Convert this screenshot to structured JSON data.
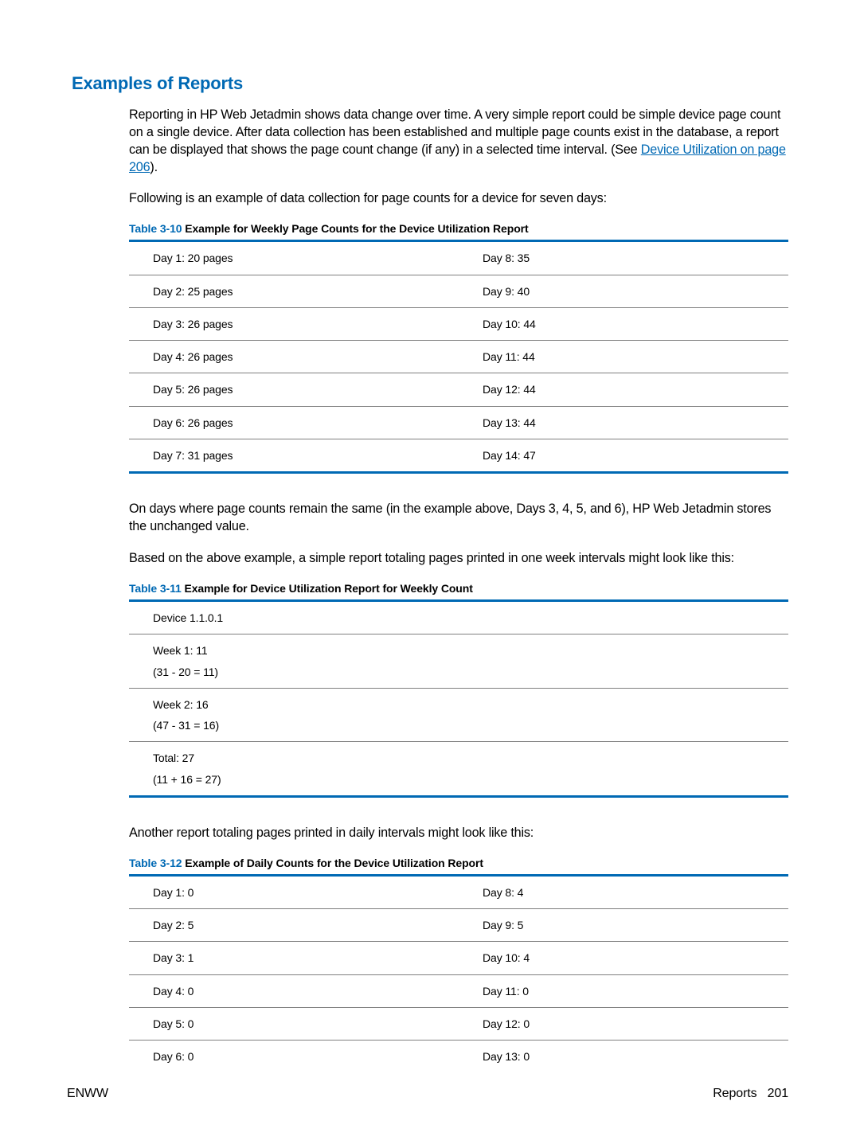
{
  "heading": "Examples of Reports",
  "para1_a": "Reporting in HP Web Jetadmin shows data change over time. A very simple report could be simple device page count on a single device. After data collection has been established and multiple page counts exist in the database, a report can be displayed that shows the page count change (if any) in a selected time interval. (See ",
  "para1_link": "Device Utilization on page 206",
  "para1_b": ").",
  "para2": "Following is an example of data collection for page counts for a device for seven days:",
  "table1": {
    "caption_prefix": "Table 3-10",
    "caption_title": "  Example for Weekly Page Counts for the Device Utilization Report",
    "rows": [
      {
        "l": "Day 1: 20 pages",
        "r": "Day 8: 35"
      },
      {
        "l": "Day 2: 25 pages",
        "r": "Day 9: 40"
      },
      {
        "l": "Day 3: 26 pages",
        "r": "Day 10: 44"
      },
      {
        "l": "Day 4: 26 pages",
        "r": "Day 11: 44"
      },
      {
        "l": "Day 5: 26 pages",
        "r": "Day 12: 44"
      },
      {
        "l": "Day 6: 26 pages",
        "r": "Day 13: 44"
      },
      {
        "l": "Day 7: 31 pages",
        "r": "Day 14: 47"
      }
    ]
  },
  "para3": "On days where page counts remain the same (in the example above, Days 3, 4, 5, and 6), HP Web Jetadmin stores the unchanged value.",
  "para4": "Based on the above example, a simple report totaling pages printed in one week intervals might look like this:",
  "table2": {
    "caption_prefix": "Table 3-11",
    "caption_title": "  Example for Device Utilization Report for Weekly Count",
    "rows": [
      {
        "l": "Device 1.1.0.1",
        "sub": ""
      },
      {
        "l": "Week 1: 11",
        "sub": "(31 - 20 = 11)"
      },
      {
        "l": "Week 2: 16",
        "sub": "(47 - 31 = 16)"
      },
      {
        "l": "Total: 27",
        "sub": "(11 + 16 = 27)"
      }
    ]
  },
  "para5": "Another report totaling pages printed in daily intervals might look like this:",
  "table3": {
    "caption_prefix": "Table 3-12",
    "caption_title": "  Example of Daily Counts for the Device Utilization Report",
    "rows": [
      {
        "l": "Day 1: 0",
        "r": "Day 8: 4"
      },
      {
        "l": "Day 2: 5",
        "r": "Day 9: 5"
      },
      {
        "l": "Day 3: 1",
        "r": "Day 10: 4"
      },
      {
        "l": "Day 4: 0",
        "r": "Day 11: 0"
      },
      {
        "l": "Day 5: 0",
        "r": "Day 12: 0"
      },
      {
        "l": "Day 6: 0",
        "r": "Day 13: 0"
      }
    ]
  },
  "footer": {
    "left": "ENWW",
    "right_label": "Reports",
    "right_page": "201"
  }
}
